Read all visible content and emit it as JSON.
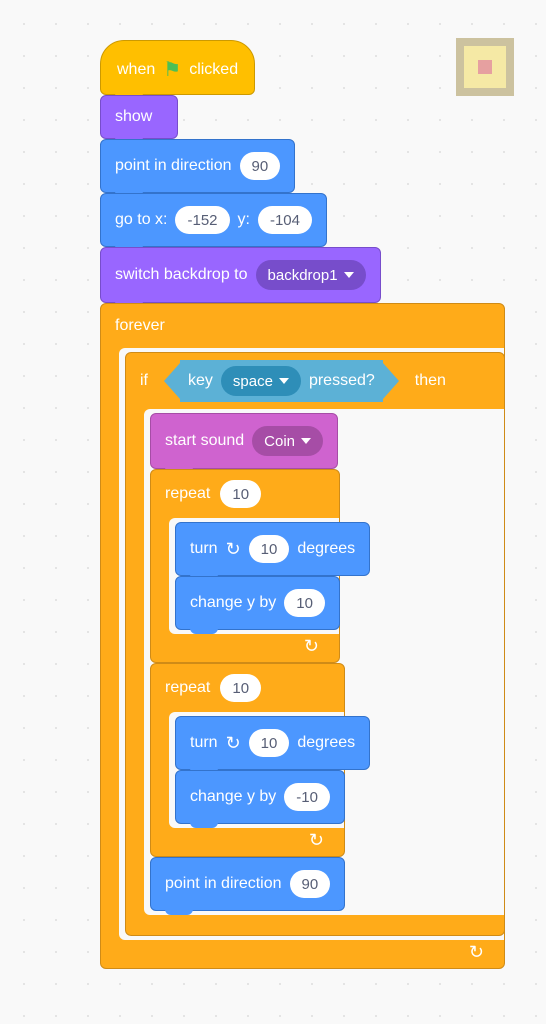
{
  "hat": {
    "label_pre": "when",
    "label_post": "clicked"
  },
  "show": {
    "label": "show"
  },
  "point_dir": {
    "label_pre": "point in direction",
    "value": "90"
  },
  "goto": {
    "label_pre": "go to x:",
    "x": "-152",
    "label_mid": "y:",
    "y": "-104"
  },
  "switch_bd": {
    "label_pre": "switch backdrop to",
    "dropdown": "backdrop1"
  },
  "forever": {
    "label": "forever"
  },
  "if": {
    "label_if": "if",
    "label_then": "then"
  },
  "key_pressed": {
    "label_pre": "key",
    "dropdown": "space",
    "label_post": "pressed?"
  },
  "start_sound": {
    "label_pre": "start sound",
    "dropdown": "Coin"
  },
  "repeat1": {
    "label": "repeat",
    "value": "10"
  },
  "turn1": {
    "label_pre": "turn",
    "value": "10",
    "label_post": "degrees"
  },
  "changey1": {
    "label_pre": "change y by",
    "value": "10"
  },
  "repeat2": {
    "label": "repeat",
    "value": "10"
  },
  "turn2": {
    "label_pre": "turn",
    "value": "10",
    "label_post": "degrees"
  },
  "changey2": {
    "label_pre": "change y by",
    "value": "-10"
  },
  "point_dir2": {
    "label_pre": "point in direction",
    "value": "90"
  }
}
